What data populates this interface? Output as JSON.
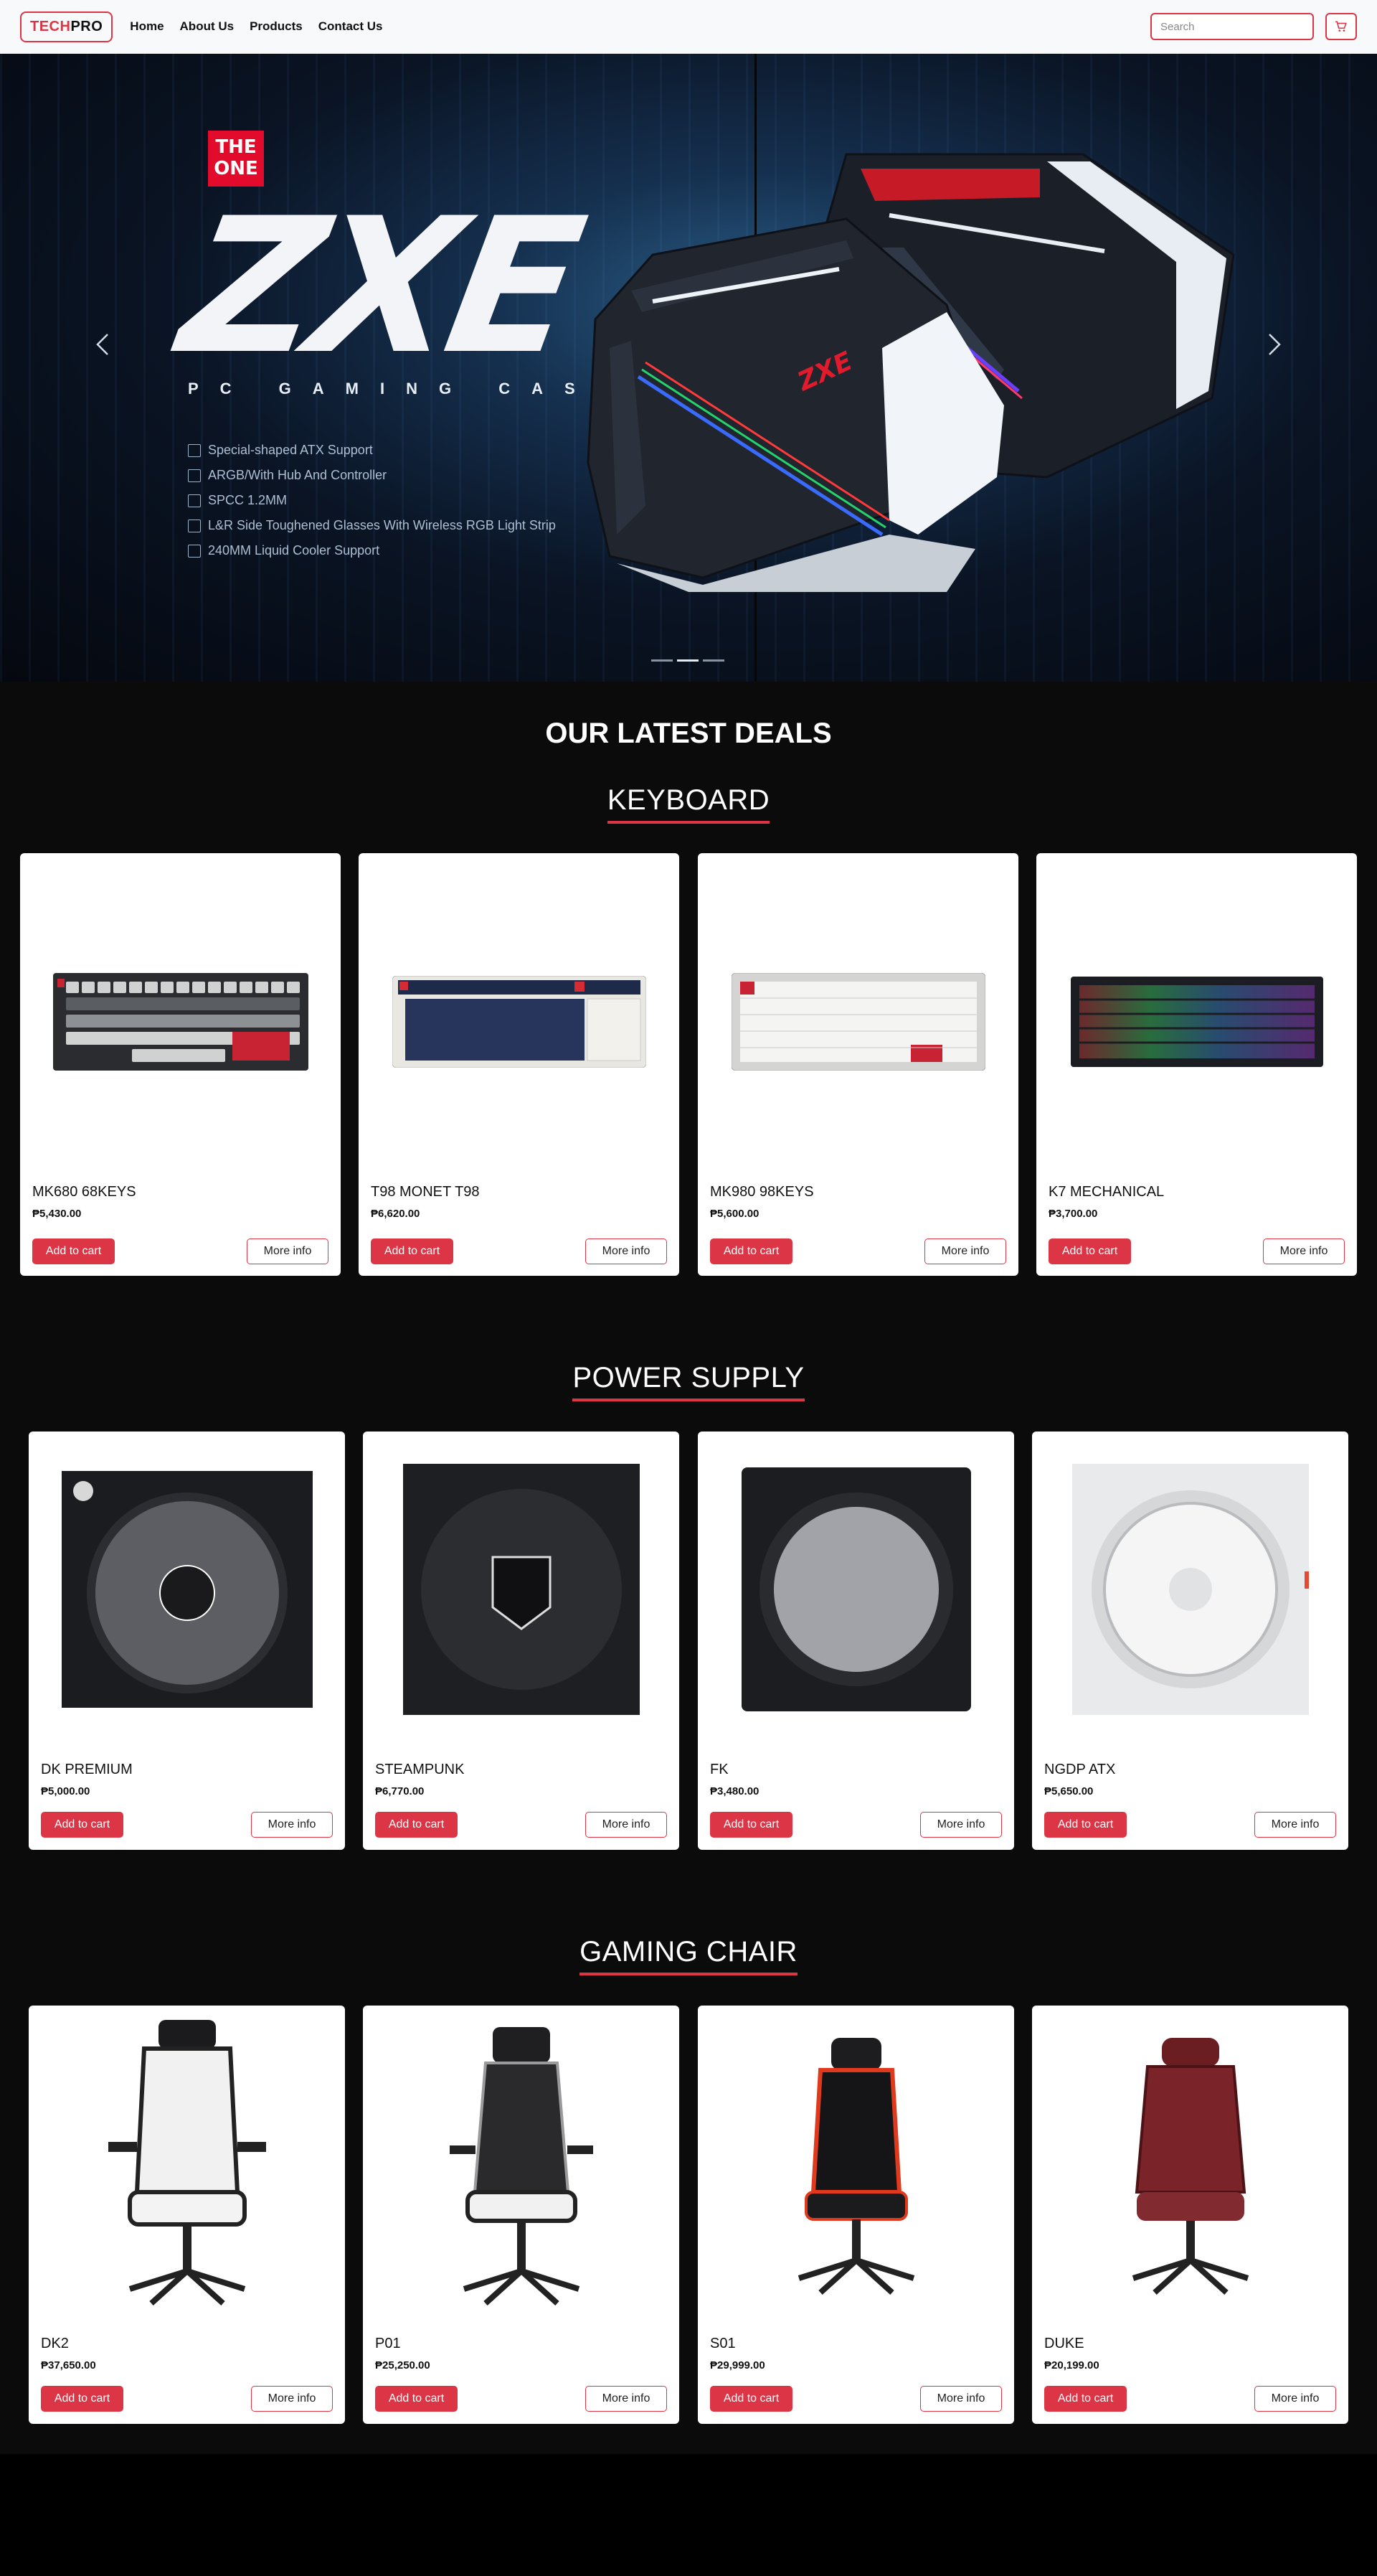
{
  "nav": {
    "brand_part1": "TECH",
    "brand_part2": "PRO",
    "links": [
      "Home",
      "About Us",
      "Products",
      "Contact Us"
    ],
    "search_placeholder": "Search",
    "cart_icon": "cart-icon"
  },
  "hero": {
    "badge_line1": "THE",
    "badge_line2": "ONE",
    "title": "ZXE",
    "subtitle": "PC GAMING CASE",
    "features": [
      "Special-shaped ATX Support",
      "ARGB/With Hub And Controller",
      "SPCC 1.2MM",
      "L&R Side Toughened Glasses With Wireless RGB Light Strip",
      "240MM Liquid Cooler Support"
    ],
    "case_logo": "ZXE",
    "prev_icon": "chevron-left-icon",
    "next_icon": "chevron-right-icon",
    "active_slide": 2,
    "slide_count": 3
  },
  "deals_title": "OUR LATEST DEALS",
  "sections": [
    {
      "heading": "KEYBOARD",
      "products": [
        {
          "name": "MK680 68KEYS",
          "price": "₱5,430.00"
        },
        {
          "name": "T98 MONET T98",
          "price": "₱6,620.00"
        },
        {
          "name": "MK980 98KEYS",
          "price": "₱5,600.00"
        },
        {
          "name": "K7 MECHANICAL",
          "price": "₱3,700.00"
        }
      ]
    },
    {
      "heading": "POWER SUPPLY",
      "products": [
        {
          "name": "DK PREMIUM",
          "price": "₱5,000.00"
        },
        {
          "name": "STEAMPUNK",
          "price": "₱6,770.00"
        },
        {
          "name": "FK",
          "price": "₱3,480.00"
        },
        {
          "name": "NGDP ATX",
          "price": "₱5,650.00"
        }
      ]
    },
    {
      "heading": "GAMING CHAIR",
      "products": [
        {
          "name": "DK2",
          "price": "₱37,650.00"
        },
        {
          "name": "P01",
          "price": "₱25,250.00"
        },
        {
          "name": "S01",
          "price": "₱29,999.00"
        },
        {
          "name": "DUKE",
          "price": "₱20,199.00"
        }
      ]
    }
  ],
  "buttons": {
    "add_to_cart": "Add to cart",
    "more_info": "More info"
  },
  "colors": {
    "accent": "#dc3545",
    "page_bg": "#0b0b0c",
    "nav_bg": "#f8f9fa"
  }
}
